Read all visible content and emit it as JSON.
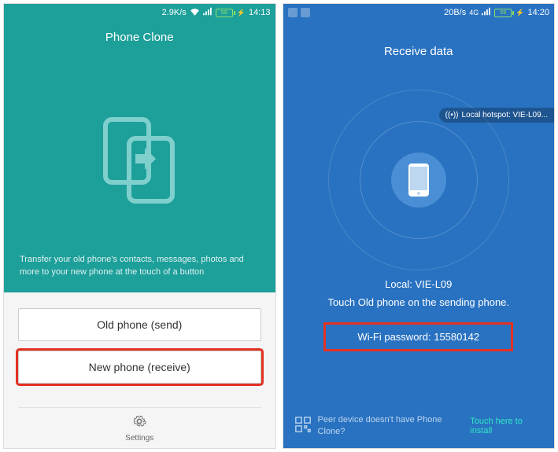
{
  "left": {
    "status": {
      "speed": "2.9K/s",
      "battery": "59",
      "time": "14:13"
    },
    "title": "Phone Clone",
    "description": "Transfer your old phone's contacts, messages, photos and more to your new phone at the touch of a button",
    "buttons": {
      "old": "Old phone (send)",
      "new": "New phone (receive)"
    },
    "footer": {
      "settings": "Settings"
    }
  },
  "right": {
    "status": {
      "speed": "20B/s",
      "net": "4G",
      "battery": "59",
      "time": "14:20"
    },
    "title": "Receive data",
    "hotspot": "Local hotspot: VIE-L09...",
    "local_name": "Local: VIE-L09",
    "instruction": "Touch Old phone on the sending phone.",
    "wifi_password_label": "Wi-Fi password: 15580142",
    "peer_text": "Peer device doesn't have Phone Clone?",
    "touch_install": "Touch here to install"
  }
}
